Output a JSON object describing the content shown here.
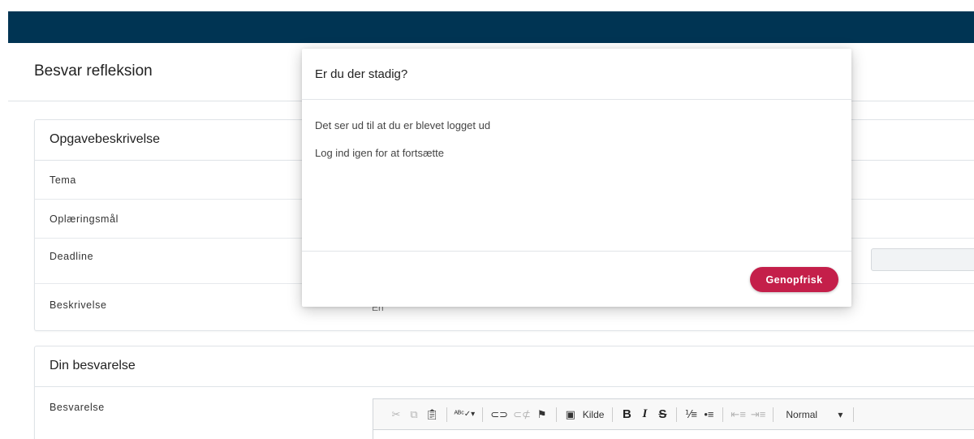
{
  "page": {
    "title": "Besvar refleksion"
  },
  "task_card": {
    "header": "Opgavebeskrivelse",
    "rows": [
      {
        "label": "Tema"
      },
      {
        "label": "Oplæringsmål"
      },
      {
        "label": "Deadline"
      },
      {
        "label": "Beskrivelse",
        "value": "En"
      }
    ]
  },
  "answer_card": {
    "header": "Din besvarelse",
    "field_label": "Besvarelse",
    "toolbar": {
      "icons": [
        "cut-icon",
        "copy-icon",
        "paste-icon",
        "spellcheck-icon",
        "link-icon",
        "unlink-icon",
        "anchor-flag-icon",
        "source-icon",
        "bold-icon",
        "italic-icon",
        "strikethrough-icon",
        "numbered-list-icon",
        "bulleted-list-icon",
        "outdent-icon",
        "indent-icon"
      ],
      "source_label": "Kilde",
      "bold_label": "B",
      "italic_label": "I",
      "strike_label": "S",
      "format_value": "Normal"
    }
  },
  "modal": {
    "title": "Er du der stadig?",
    "line1": "Det ser ud til at du er blevet logget ud",
    "line2": "Log ind igen for at fortsætte",
    "button_label": "Genopfrisk"
  },
  "colors": {
    "navbar": "#003453",
    "primary_button": "#c41f4a"
  }
}
